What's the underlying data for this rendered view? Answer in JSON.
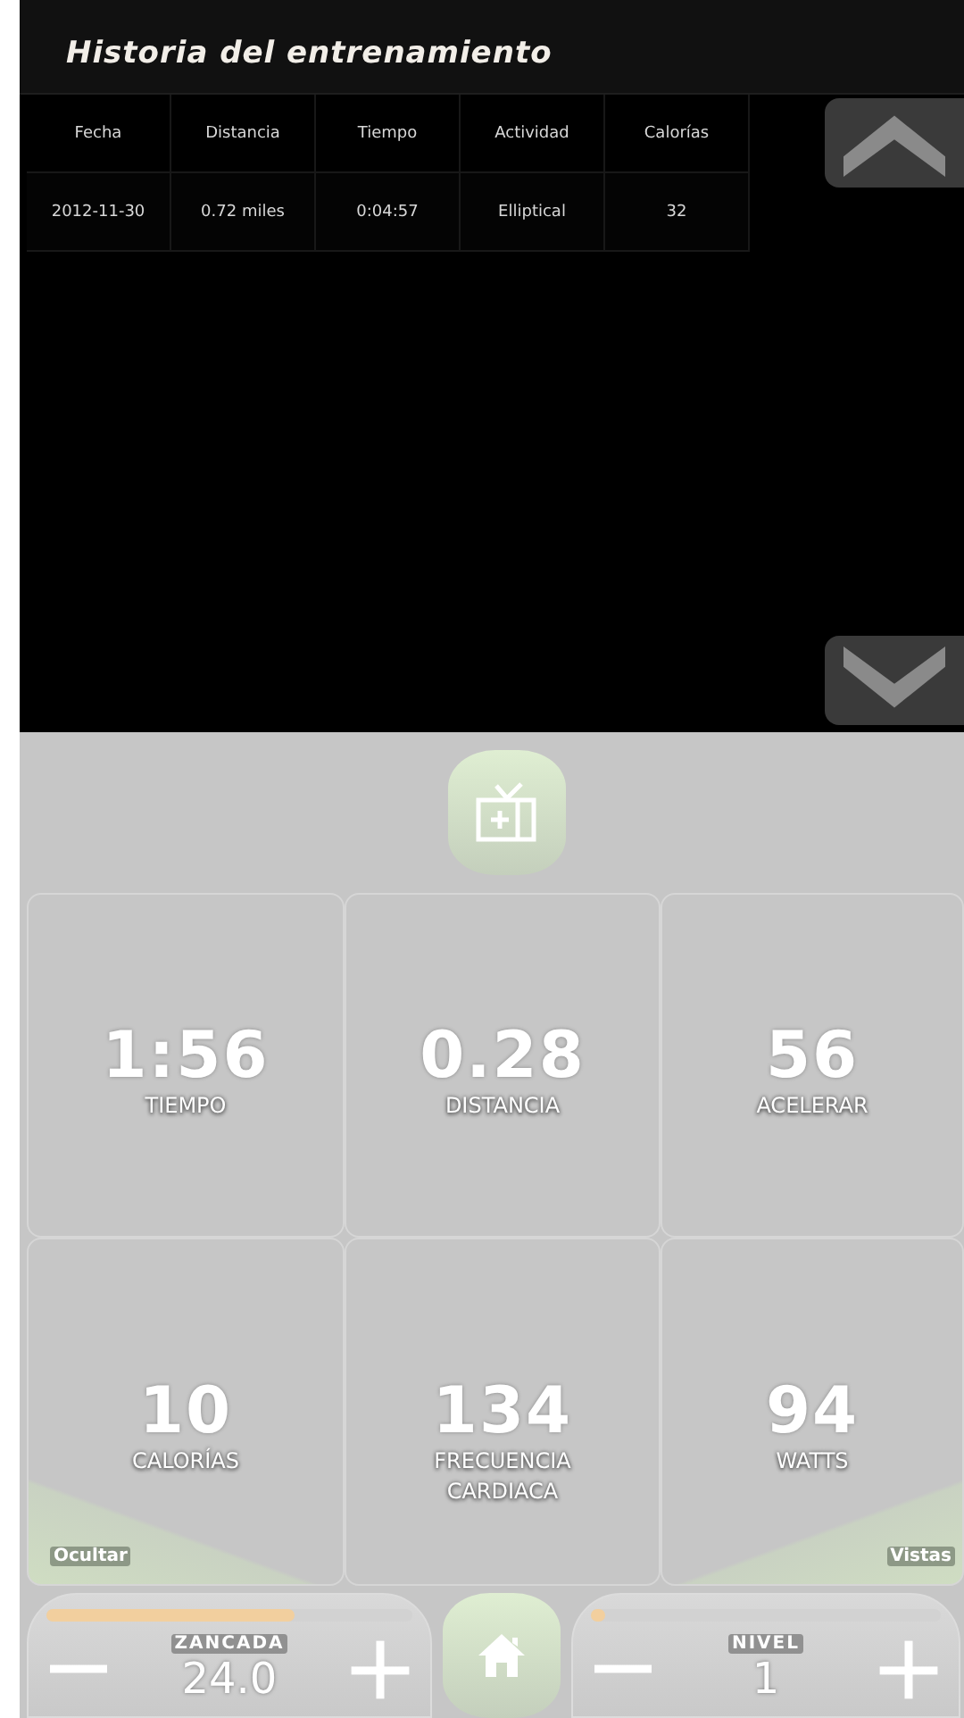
{
  "history": {
    "title": "Historia del entrenamiento",
    "columns": [
      "Fecha",
      "Distancia",
      "Tiempo",
      "Actividad",
      "Calorías"
    ],
    "rows": [
      [
        "2012-11-30",
        "0.72 miles",
        "0:04:57",
        "Elliptical",
        "32"
      ]
    ]
  },
  "stats": [
    {
      "value": "1:56",
      "label": "TIEMPO"
    },
    {
      "value": "0.28",
      "label": "DISTANCIA"
    },
    {
      "value": "56",
      "label": "ACELERAR"
    },
    {
      "value": "10",
      "label": "CALORÍAS"
    },
    {
      "value": "134",
      "label": "FRECUENCIA CARDIACA"
    },
    {
      "value": "94",
      "label": "WATTS"
    }
  ],
  "corner_left": "Ocultar",
  "corner_right": "Vistas",
  "controls": [
    {
      "label": "ZANCADA",
      "value": "24.0",
      "level": 0.68
    },
    {
      "label": "NIVEL",
      "value": "1",
      "level": 0.04
    }
  ]
}
